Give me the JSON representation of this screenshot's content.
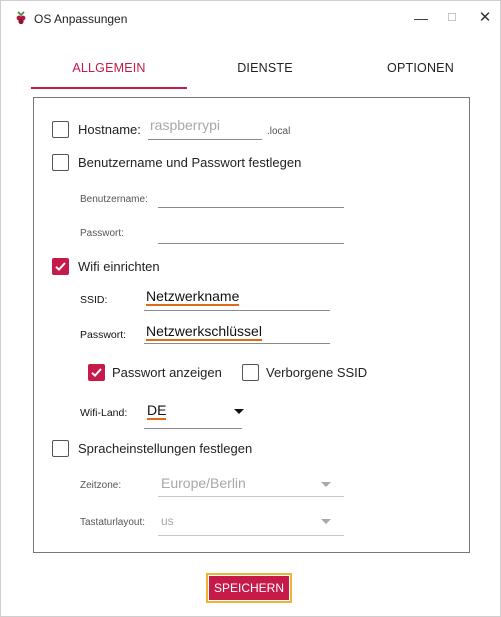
{
  "window": {
    "title": "OS Anpassungen",
    "minimize": "—",
    "maximize": "☐",
    "close": "✕",
    "accent": "#c51a4a"
  },
  "tabs": [
    {
      "label": "ALLGEMEIN",
      "active": true
    },
    {
      "label": "DIENSTE",
      "active": false
    },
    {
      "label": "OPTIONEN",
      "active": false
    }
  ],
  "general": {
    "hostname": {
      "label": "Hostname:",
      "checked": false,
      "placeholder": "raspberrypi",
      "suffix": ".local"
    },
    "user": {
      "label": "Benutzername und Passwort festlegen",
      "checked": false,
      "username_label": "Benutzername:",
      "password_label": "Passwort:"
    },
    "wifi": {
      "label": "Wifi einrichten",
      "checked": true,
      "ssid_label": "SSID:",
      "ssid_value": "Netzwerkname",
      "password_label": "Passwort:",
      "password_value": "Netzwerkschlüssel",
      "show_password_label": "Passwort anzeigen",
      "show_password_checked": true,
      "hidden_ssid_label": "Verborgene SSID",
      "hidden_ssid_checked": false,
      "country_label": "Wifi-Land:",
      "country_value": "DE"
    },
    "locale": {
      "label": "Spracheinstellungen festlegen",
      "checked": false,
      "timezone_label": "Zeitzone:",
      "timezone_value": "Europe/Berlin",
      "keyboard_label": "Tastaturlayout:",
      "keyboard_value": "us"
    }
  },
  "save_label": "SPEICHERN"
}
